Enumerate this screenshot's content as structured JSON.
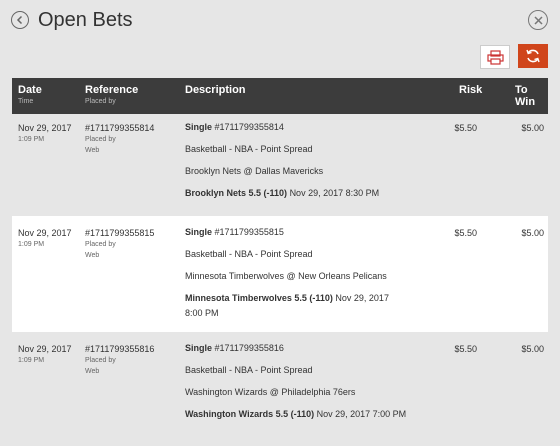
{
  "title": "Open Bets",
  "columns": {
    "date": "Date",
    "date_sub": "Time",
    "reference": "Reference",
    "reference_sub": "Placed by",
    "description": "Description",
    "risk": "Risk",
    "to_win": "To Win"
  },
  "bets": [
    {
      "date": "Nov 29, 2017",
      "time": "1:09 PM",
      "reference": "#1711799355814",
      "placed_by_label": "Placed by",
      "placed_by": "Web",
      "type": "Single",
      "type_ref": "#1711799355814",
      "market": "Basketball - NBA - Point Spread",
      "event": "Brooklyn Nets @ Dallas Mavericks",
      "selection": "Brooklyn Nets 5.5 (-110)",
      "event_time": "Nov 29, 2017 8:30 PM",
      "risk": "$5.50",
      "to_win": "$5.00"
    },
    {
      "date": "Nov 29, 2017",
      "time": "1:09 PM",
      "reference": "#1711799355815",
      "placed_by_label": "Placed by",
      "placed_by": "Web",
      "type": "Single",
      "type_ref": "#1711799355815",
      "market": "Basketball - NBA - Point Spread",
      "event": "Minnesota Timberwolves @ New Orleans Pelicans",
      "selection": "Minnesota Timberwolves 5.5 (-110)",
      "event_time": "Nov 29, 2017 8:00 PM",
      "risk": "$5.50",
      "to_win": "$5.00"
    },
    {
      "date": "Nov 29, 2017",
      "time": "1:09 PM",
      "reference": "#1711799355816",
      "placed_by_label": "Placed by",
      "placed_by": "Web",
      "type": "Single",
      "type_ref": "#1711799355816",
      "market": "Basketball - NBA - Point Spread",
      "event": "Washington Wizards @ Philadelphia 76ers",
      "selection": "Washington Wizards 5.5 (-110)",
      "event_time": "Nov 29, 2017 7:00 PM",
      "risk": "$5.50",
      "to_win": "$5.00"
    }
  ],
  "icons": {
    "back": "chevron-left-icon",
    "close": "close-icon",
    "print": "print-icon",
    "refresh": "refresh-icon"
  },
  "colors": {
    "accent": "#d0451b",
    "header_bg": "#3c3c3c"
  }
}
